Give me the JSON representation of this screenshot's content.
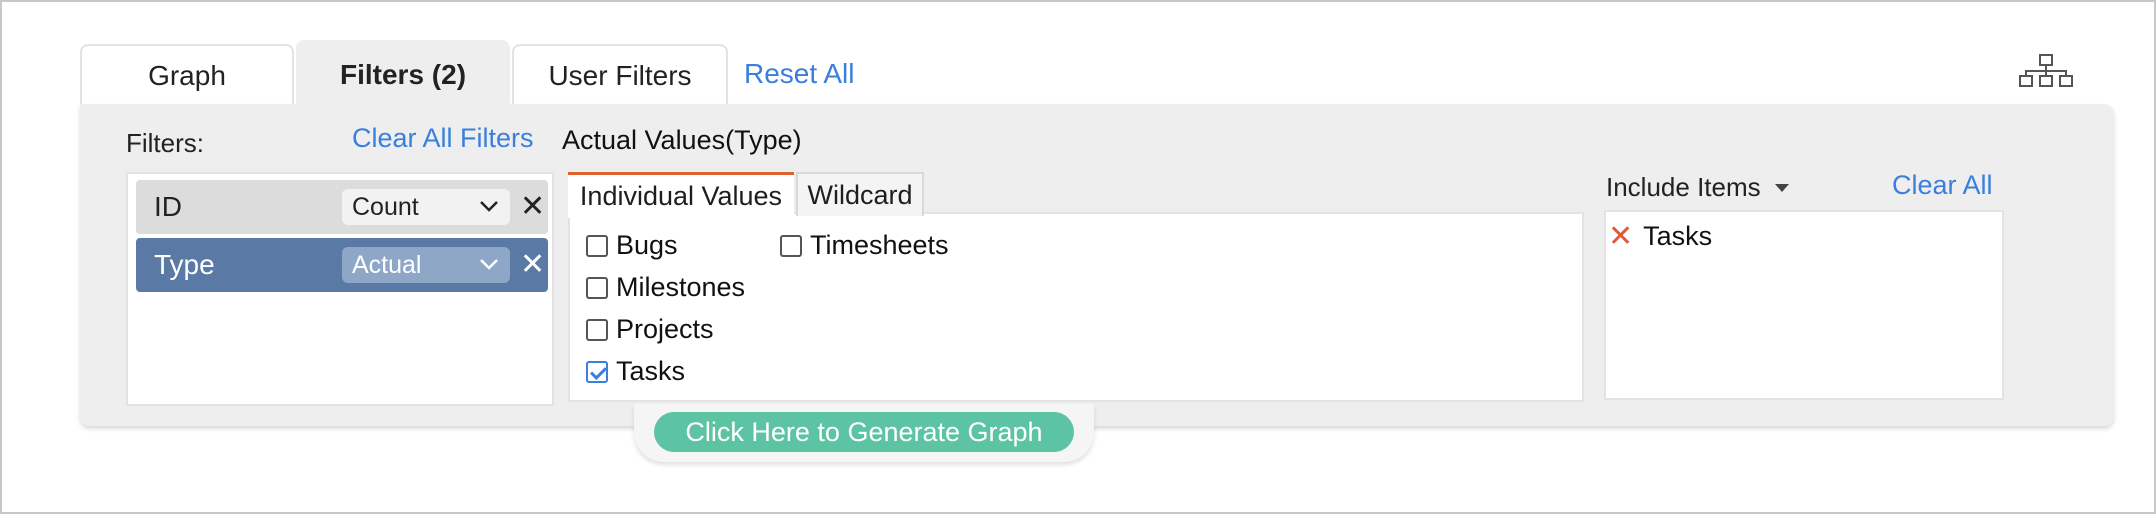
{
  "tabs": {
    "graph": "Graph",
    "filters": "Filters (2)",
    "user_filters": "User Filters"
  },
  "reset_all": "Reset All",
  "filters_panel": {
    "label": "Filters:",
    "clear_all_filters": "Clear All Filters",
    "rows": [
      {
        "name": "ID",
        "aggregation": "Count"
      },
      {
        "name": "Type",
        "aggregation": "Actual"
      }
    ],
    "remove_glyph": "✕"
  },
  "values_panel": {
    "title": "Actual Values(Type)",
    "tabs": [
      "Individual Values",
      "Wildcard"
    ],
    "items": [
      {
        "label": "Bugs",
        "checked": false
      },
      {
        "label": "Milestones",
        "checked": false
      },
      {
        "label": "Projects",
        "checked": false
      },
      {
        "label": "Tasks",
        "checked": true
      },
      {
        "label": "Timesheets",
        "checked": false
      }
    ]
  },
  "include_panel": {
    "mode": "Include Items",
    "clear_all": "Clear All",
    "items": [
      "Tasks"
    ],
    "remove_glyph": "✕"
  },
  "generate_button": "Click Here to Generate Graph",
  "colors": {
    "link": "#3a7fdb",
    "selected_row": "#5a7aa5",
    "active_tab_underline": "#e0602e",
    "generate_button": "#5cc4a2",
    "remove_x": "#e05a3a"
  },
  "icons": {
    "top_right": "hierarchy-icon",
    "dropdown": "chevron-down-icon"
  }
}
